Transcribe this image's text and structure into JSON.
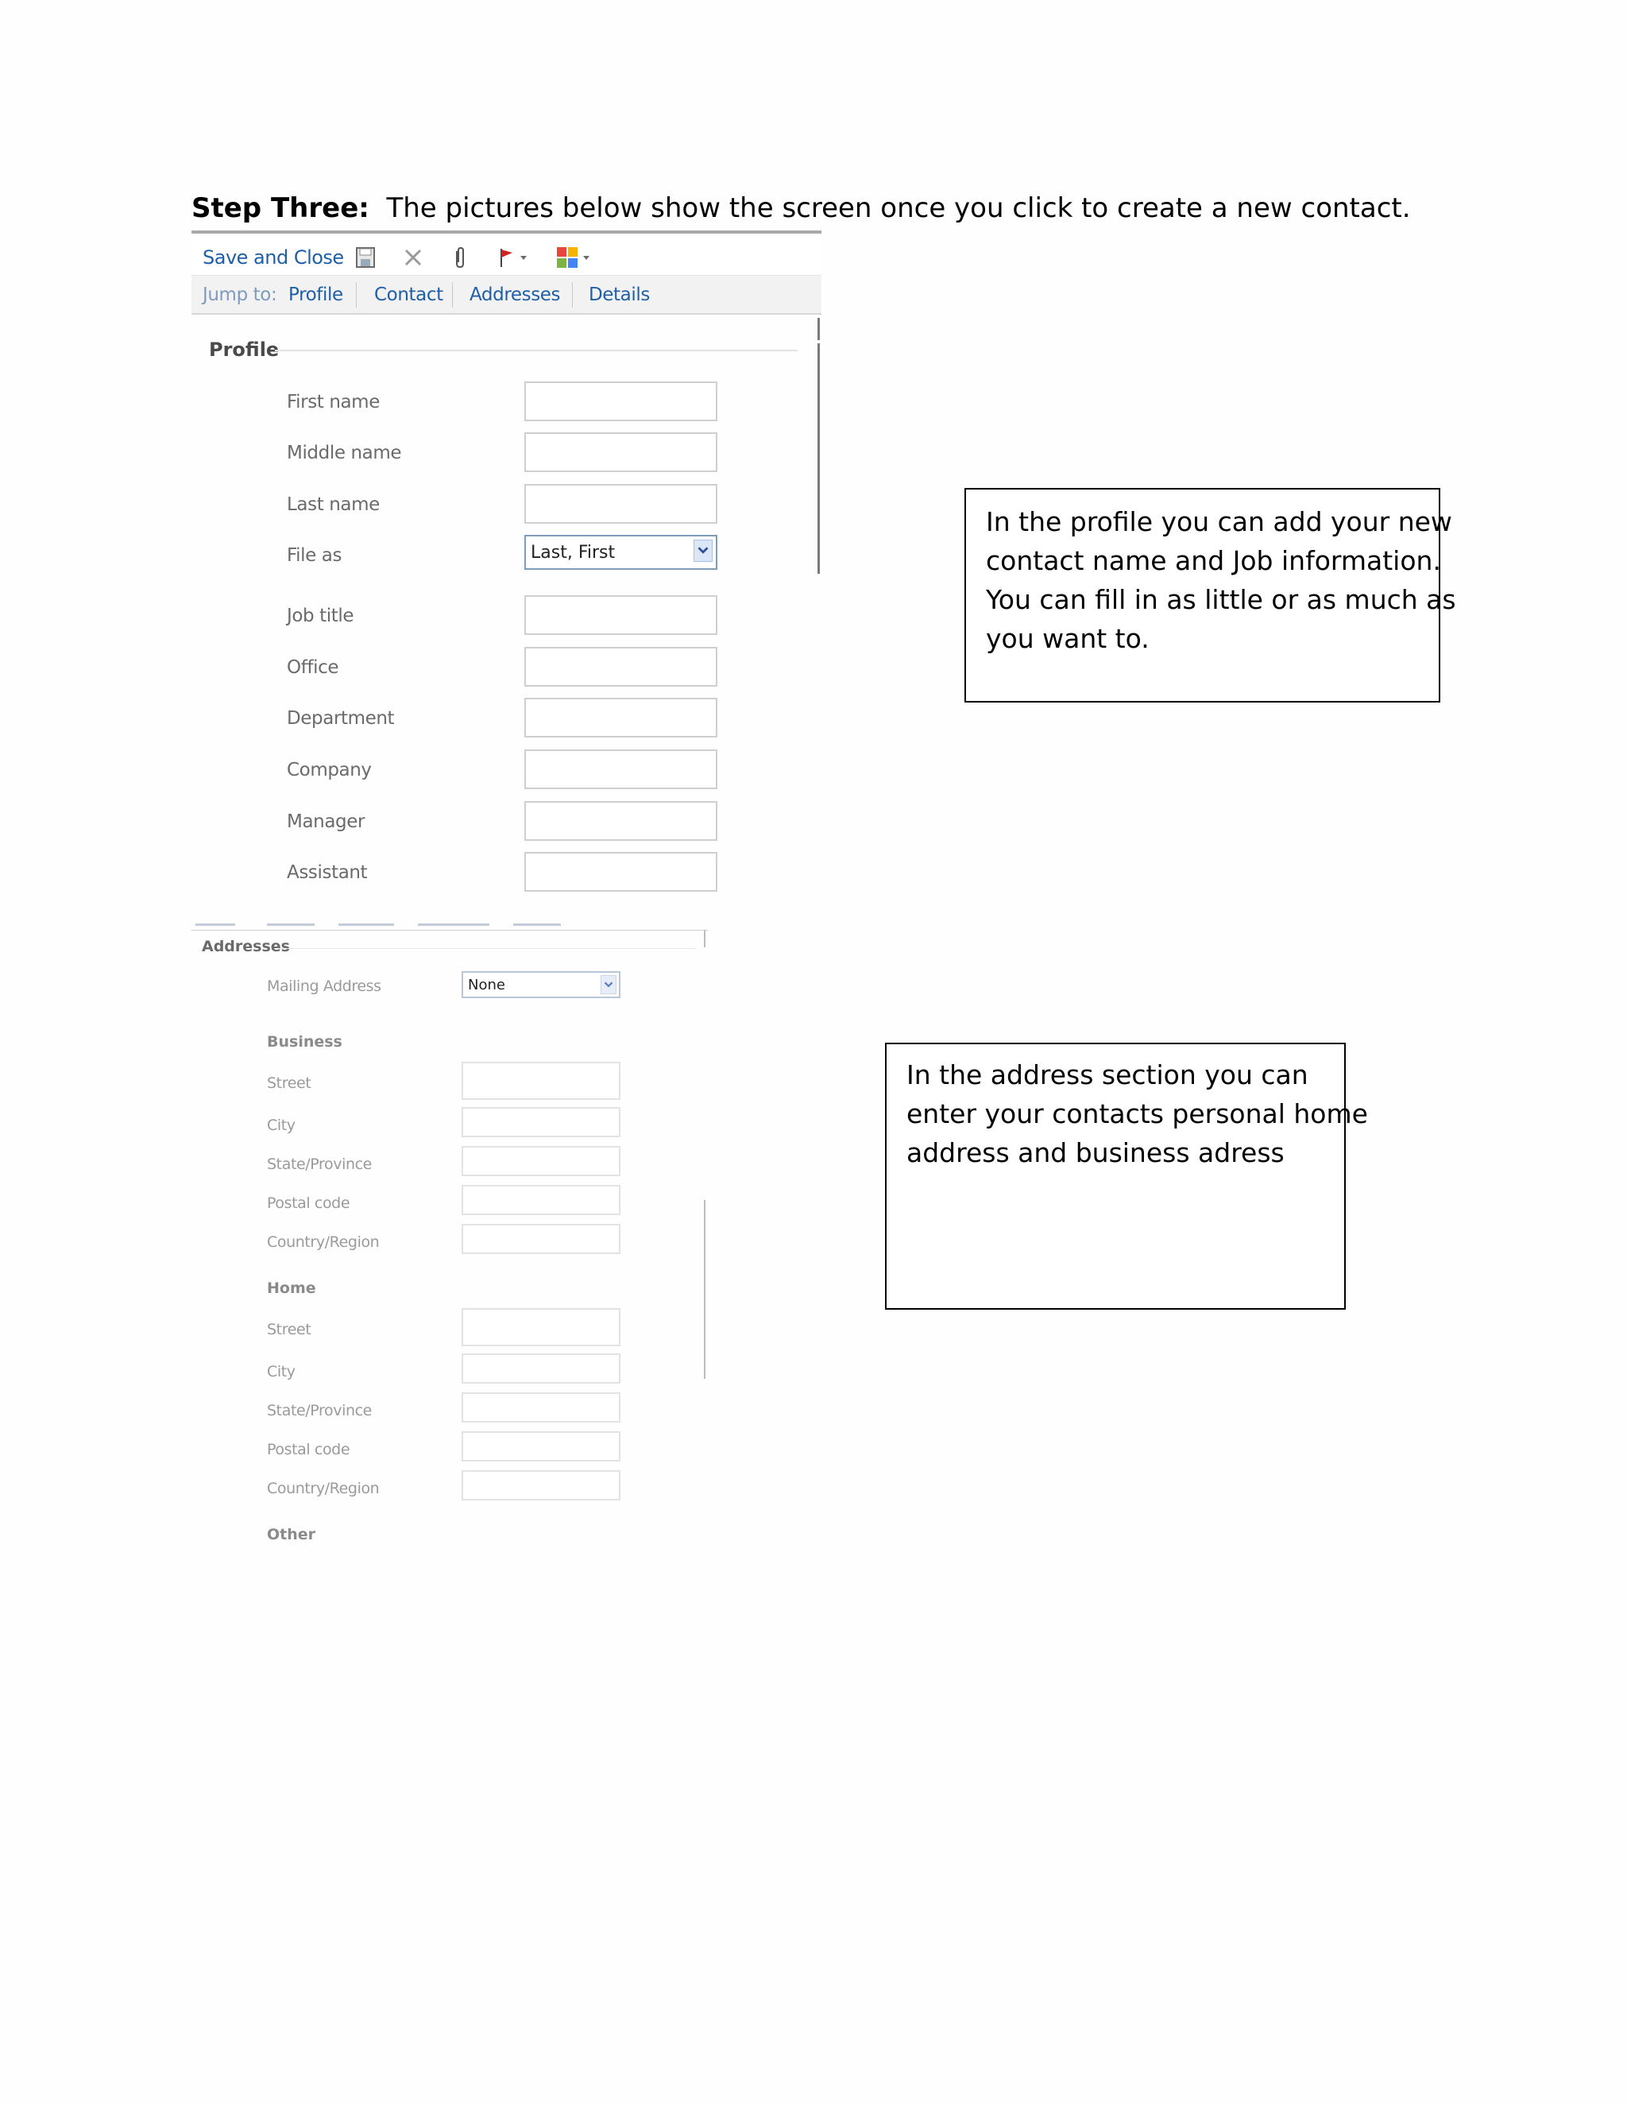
{
  "heading": {
    "bold": "Step Three:",
    "text": "  The pictures below show the screen once you click to create a new contact."
  },
  "toolbar": {
    "save_close": "Save and Close",
    "icons": [
      "save-icon",
      "delete-icon",
      "attach-icon",
      "flag-icon",
      "categories-icon"
    ]
  },
  "jump": {
    "label": "Jump to:",
    "links": [
      "Profile",
      "Contact",
      "Addresses",
      "Details"
    ]
  },
  "profile": {
    "title": "Profile",
    "fields": [
      "First name",
      "Middle name",
      "Last name",
      "File as",
      "Job title",
      "Office",
      "Department",
      "Company",
      "Manager",
      "Assistant"
    ],
    "file_as_value": "Last, First"
  },
  "addresses": {
    "title": "Addresses",
    "mailing_label": "Mailing Address",
    "mailing_value": "None",
    "business_title": "Business",
    "business_fields": [
      "Street",
      "City",
      "State/Province",
      "Postal code",
      "Country/Region"
    ],
    "home_title": "Home",
    "home_fields": [
      "Street",
      "City",
      "State/Province",
      "Postal code",
      "Country/Region"
    ],
    "other_title": "Other"
  },
  "callouts": {
    "profile_lines": [
      "In the profile you can add your new",
      "contact name and Job information.",
      "You can fill in as little or as much as",
      "you want to."
    ],
    "address_lines": [
      "In the address section you can",
      "enter your contacts personal home",
      "address and business adress"
    ]
  }
}
